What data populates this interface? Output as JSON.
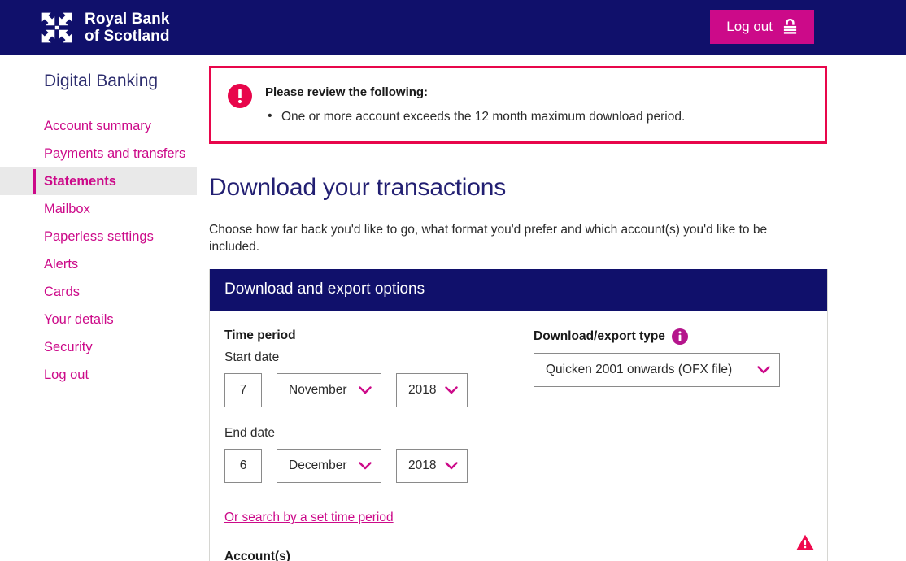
{
  "brand": {
    "logo_icon": "rbs-daisy-wheel-logo",
    "line1": "Royal Bank",
    "line2": "of Scotland"
  },
  "header": {
    "logout_label": "Log out",
    "logout_icon": "padlock-icon"
  },
  "sidebar": {
    "title": "Digital Banking",
    "items": [
      {
        "label": "Account summary",
        "active": false
      },
      {
        "label": "Payments and transfers",
        "active": false
      },
      {
        "label": "Statements",
        "active": true
      },
      {
        "label": "Mailbox",
        "active": false
      },
      {
        "label": "Paperless settings",
        "active": false
      },
      {
        "label": "Alerts",
        "active": false
      },
      {
        "label": "Cards",
        "active": false
      },
      {
        "label": "Your details",
        "active": false
      },
      {
        "label": "Security",
        "active": false
      },
      {
        "label": "Log out",
        "active": false
      }
    ]
  },
  "error_banner": {
    "icon": "exclamation-circle-icon",
    "title": "Please review the following:",
    "messages": [
      "One or more account exceeds the 12 month maximum download period."
    ]
  },
  "main": {
    "page_title": "Download your transactions",
    "intro": "Choose how far back you'd like to go, what format you'd prefer and which account(s) you'd like to be included."
  },
  "panel": {
    "header": "Download and export options",
    "time_period_label": "Time period",
    "start_date_label": "Start date",
    "end_date_label": "End date",
    "start_date": {
      "day": "7",
      "month": "November",
      "year": "2018"
    },
    "end_date": {
      "day": "6",
      "month": "December",
      "year": "2018"
    },
    "export_type_label": "Download/export type",
    "export_type_info_icon": "info-icon",
    "export_type_value": "Quicken 2001 onwards (OFX file)",
    "set_period_link": "Or search by a set time period",
    "accounts_label": "Account(s)",
    "warning_icon": "warning-triangle-icon"
  },
  "colors": {
    "navy": "#10106b",
    "magenta": "#cc0a89",
    "crimson": "#e8064b",
    "heading_navy": "#221f72",
    "active_bg": "#e9e9e9",
    "border_grey": "#8a8a8a"
  }
}
